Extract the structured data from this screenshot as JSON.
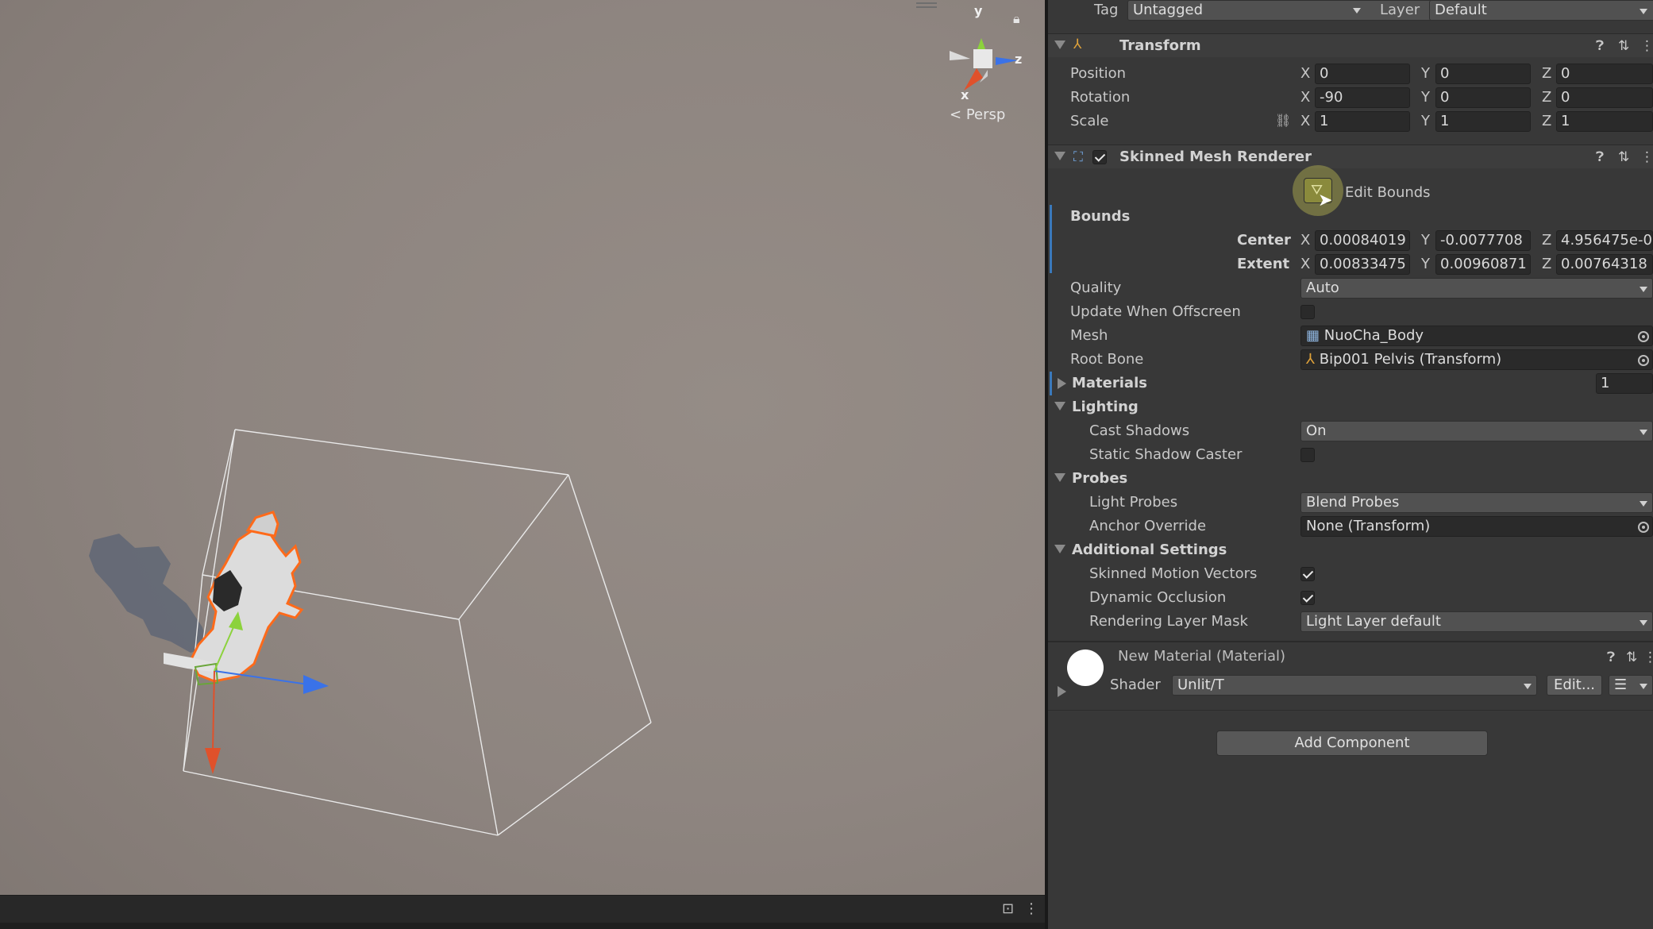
{
  "scene": {
    "persp_label": "Persp",
    "gizmo_axes": {
      "y": "y",
      "z": "z",
      "x": "x"
    }
  },
  "inspector": {
    "tag_label": "Tag",
    "tag_value": "Untagged",
    "layer_label": "Layer",
    "layer_value": "Default",
    "transform": {
      "title": "Transform",
      "position": {
        "label": "Position",
        "x": "0",
        "y": "0",
        "z": "0"
      },
      "rotation": {
        "label": "Rotation",
        "x": "-90",
        "y": "0",
        "z": "0"
      },
      "scale": {
        "label": "Scale",
        "x": "1",
        "y": "1",
        "z": "1"
      }
    },
    "axis_labels": {
      "x": "X",
      "y": "Y",
      "z": "Z"
    },
    "renderer": {
      "title": "Skinned Mesh Renderer",
      "enabled": true,
      "edit_bounds_label": "Edit Bounds",
      "bounds_label": "Bounds",
      "center": {
        "label": "Center",
        "x": "0.00084019",
        "y": "-0.0077708",
        "z": "4.956475e-0"
      },
      "extent": {
        "label": "Extent",
        "x": "0.00833475",
        "y": "0.00960871",
        "z": "0.00764318"
      },
      "quality": {
        "label": "Quality",
        "value": "Auto"
      },
      "update_offscreen": {
        "label": "Update When Offscreen",
        "checked": false
      },
      "mesh": {
        "label": "Mesh",
        "value": "NuoCha_Body"
      },
      "root_bone": {
        "label": "Root Bone",
        "value": "Bip001 Pelvis (Transform)"
      },
      "materials": {
        "label": "Materials",
        "count": "1"
      },
      "lighting": {
        "label": "Lighting",
        "cast_shadows": {
          "label": "Cast Shadows",
          "value": "On"
        },
        "static_shadow": {
          "label": "Static Shadow Caster",
          "checked": false
        }
      },
      "probes": {
        "label": "Probes",
        "light_probes": {
          "label": "Light Probes",
          "value": "Blend Probes"
        },
        "anchor_override": {
          "label": "Anchor Override",
          "value": "None (Transform)"
        }
      },
      "additional": {
        "label": "Additional Settings",
        "motion_vectors": {
          "label": "Skinned Motion Vectors",
          "checked": true
        },
        "dynamic_occlusion": {
          "label": "Dynamic Occlusion",
          "checked": true
        },
        "layer_mask": {
          "label": "Rendering Layer Mask",
          "value": "Light Layer default"
        }
      }
    },
    "material": {
      "title": "New Material (Material)",
      "shader_label": "Shader",
      "shader_value": "Unlit/T",
      "edit_label": "Edit..."
    },
    "add_component_label": "Add Component"
  },
  "colors": {
    "axis_x": "#e0512b",
    "axis_y": "#8cd23c",
    "axis_z": "#3a72e8",
    "selection_outline": "#ff6a1a",
    "cursor_highlight": "#e8e65a"
  }
}
